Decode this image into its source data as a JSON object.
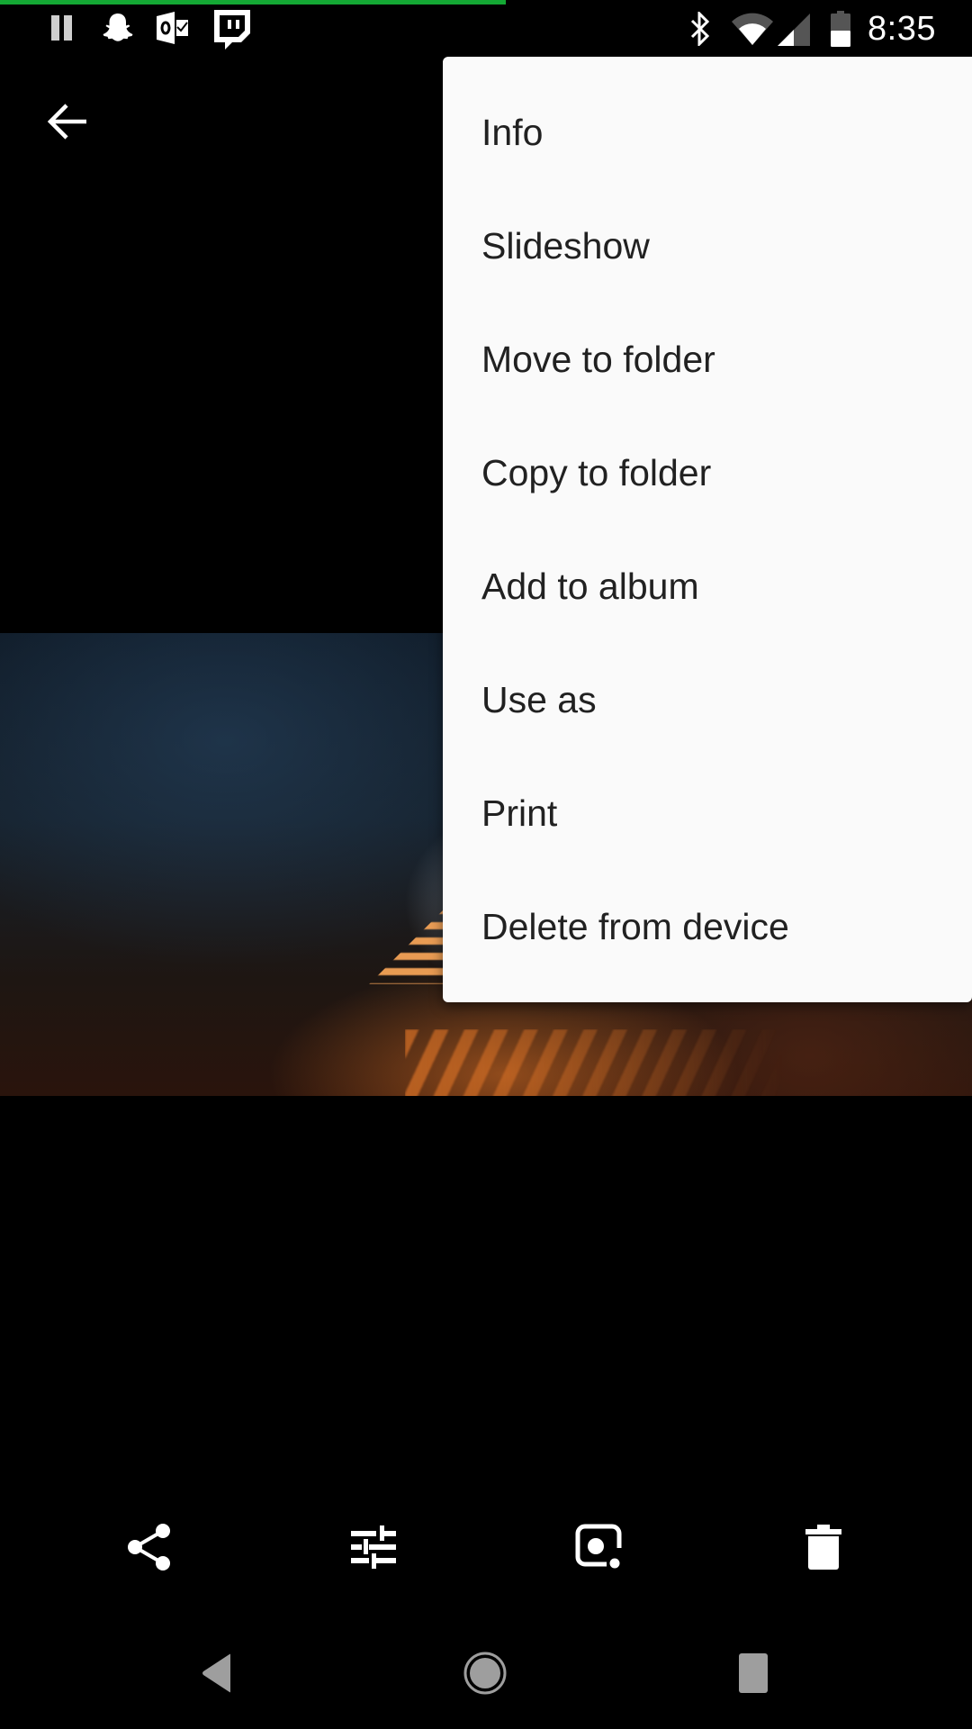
{
  "status_bar": {
    "time": "8:35",
    "media_progress_percent": 52,
    "left_icons": [
      "pause-icon",
      "snapchat-icon",
      "outlook-icon",
      "twitch-icon"
    ],
    "right_icons": [
      "bluetooth-icon",
      "wifi-icon",
      "cell-signal-icon",
      "battery-icon"
    ]
  },
  "toolbar": {
    "back_icon": "arrow-back-icon"
  },
  "overflow_menu": {
    "items": [
      {
        "label": "Info"
      },
      {
        "label": "Slideshow"
      },
      {
        "label": "Move to folder"
      },
      {
        "label": "Copy to folder"
      },
      {
        "label": "Add to album"
      },
      {
        "label": "Use as"
      },
      {
        "label": "Print"
      },
      {
        "label": "Delete from device"
      }
    ]
  },
  "bottom_actions": [
    {
      "name": "share",
      "icon": "share-icon"
    },
    {
      "name": "edit",
      "icon": "tune-icon"
    },
    {
      "name": "lens",
      "icon": "lens-icon"
    },
    {
      "name": "delete",
      "icon": "trash-icon"
    }
  ],
  "nav_bar": [
    "back",
    "home",
    "recents"
  ],
  "colors": {
    "progress": "#14a834",
    "menu_bg": "#fafafa",
    "menu_text": "#212121",
    "nav_gray": "#9e9e9e"
  }
}
